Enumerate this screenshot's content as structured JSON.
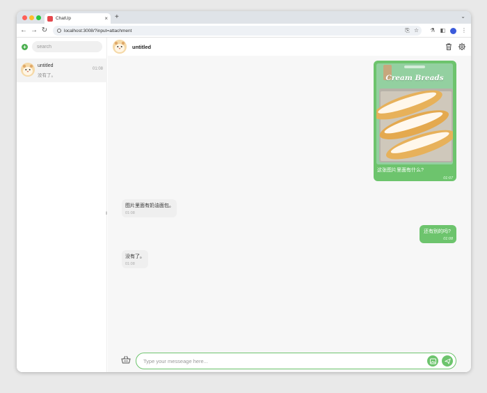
{
  "browser": {
    "tab_title": "ChatUp",
    "tab_close_glyph": "×",
    "new_tab_glyph": "+",
    "chevron_glyph": "⌄",
    "back_glyph": "←",
    "forward_glyph": "→",
    "reload_glyph": "↻",
    "url": "localhost:3008/?input=attachment",
    "translate_glyph": "⎘",
    "star_glyph": "☆",
    "extensions_glyph": "⚗",
    "sidepanel_glyph": "◧",
    "menu_glyph": "⋮"
  },
  "sidebar": {
    "add_glyph": "+",
    "search_placeholder": "search",
    "conversations": [
      {
        "title": "untitled",
        "preview": "没有了。",
        "time": "01:08"
      }
    ],
    "resize_glyph": "‖"
  },
  "chat": {
    "title": "untitled",
    "input_placeholder": "Type your messeage here...",
    "messages": [
      {
        "role": "user",
        "image_text": "Cream Breads",
        "text": "这张图片里面有什么?",
        "time": "01:07"
      },
      {
        "role": "assistant",
        "text": "图片里面有奶油面包。",
        "time": "01:08"
      },
      {
        "role": "user",
        "text": "还有别的吗?",
        "time": "01:08"
      },
      {
        "role": "assistant",
        "text": "没有了。",
        "time": "01:08"
      }
    ]
  },
  "colors": {
    "accent": "#6dc46d",
    "bubble_bot": "#efefef",
    "background": "#f7f7f7"
  },
  "icons": [
    "add-icon",
    "search-icon",
    "trash-icon",
    "gear-icon",
    "basket-icon",
    "image-icon",
    "send-icon",
    "hamster-avatar-icon"
  ]
}
